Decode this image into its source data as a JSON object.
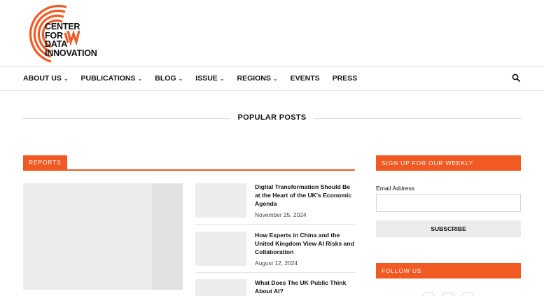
{
  "logo": {
    "lines": [
      "CENTER",
      "FOR",
      "DATA",
      "INNOVATION"
    ],
    "accent_color": "#f15a22"
  },
  "nav": {
    "items": [
      {
        "label": "ABOUT US",
        "dropdown": true
      },
      {
        "label": "PUBLICATIONS",
        "dropdown": true
      },
      {
        "label": "BLOG",
        "dropdown": true
      },
      {
        "label": "ISSUE",
        "dropdown": true
      },
      {
        "label": "REGIONS",
        "dropdown": true
      },
      {
        "label": "EVENTS",
        "dropdown": false
      },
      {
        "label": "PRESS",
        "dropdown": false
      }
    ],
    "search_icon": "search-icon"
  },
  "popular": {
    "title": "POPULAR POSTS"
  },
  "reports": {
    "label": "REPORTS",
    "posts": [
      {
        "title": "Digital Transformation Should Be at the Heart of the UK's Economic Agenda",
        "date": "November 25, 2024"
      },
      {
        "title": "How Experts in China and the United Kingdom View AI Risks and Collaboration",
        "date": "August 12, 2024"
      },
      {
        "title": "What Does The UK Public Think About AI?",
        "date": ""
      }
    ]
  },
  "sidebar": {
    "newsletter_label": "SIGN UP FOR OUR WEEKLY NEWSLETTER",
    "email_label": "Email Address",
    "email_value": "",
    "subscribe_label": "SUBSCRIBE",
    "follow_label": "FOLLOW US"
  },
  "colors": {
    "accent": "#f15a22",
    "placeholder_gray": "#ececec"
  }
}
